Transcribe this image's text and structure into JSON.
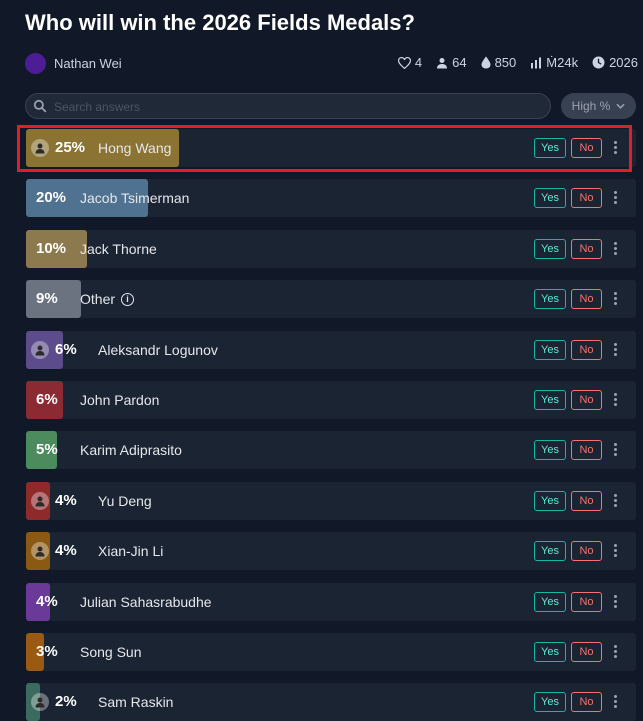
{
  "title": "Who will win the 2026 Fields Medals?",
  "author": "Nathan Wei",
  "stats": {
    "likes": "4",
    "traders": "64",
    "liquidity": "850",
    "volume": "Ṁ24k",
    "closes": "2026"
  },
  "search": {
    "placeholder": "Search answers"
  },
  "sort": {
    "label": "High %"
  },
  "buttons": {
    "yes": "Yes",
    "no": "No"
  },
  "colors": {
    "highlight": "#e11d2a",
    "yes": "#14b8a6",
    "no": "#f87171"
  },
  "answers": [
    {
      "pct": "25%",
      "name": "Hong Wang",
      "probability": 0.25,
      "color": "#8a7333",
      "icon": "avatar-icon"
    },
    {
      "pct": "20%",
      "name": "Jacob Tsimerman",
      "probability": 0.2,
      "color": "#4e7290"
    },
    {
      "pct": "10%",
      "name": "Jack Thorne",
      "probability": 0.1,
      "color": "#8c7a4e"
    },
    {
      "pct": "9%",
      "name": "Other",
      "probability": 0.09,
      "color": "#6b7280",
      "info": "i"
    },
    {
      "pct": "6%",
      "name": "Aleksandr Logunov",
      "probability": 0.06,
      "color": "#5d4c8c",
      "icon": "avatar-icon"
    },
    {
      "pct": "6%",
      "name": "John Pardon",
      "probability": 0.06,
      "color": "#8b2a33"
    },
    {
      "pct": "5%",
      "name": "Karim Adiprasito",
      "probability": 0.05,
      "color": "#4b8b5e"
    },
    {
      "pct": "4%",
      "name": "Yu Deng",
      "probability": 0.04,
      "color": "#8f2a2a",
      "icon": "avatar-icon"
    },
    {
      "pct": "4%",
      "name": "Xian-Jin Li",
      "probability": 0.04,
      "color": "#8a5a12",
      "icon": "avatar-icon"
    },
    {
      "pct": "4%",
      "name": "Julian Sahasrabudhe",
      "probability": 0.04,
      "color": "#6b3a99"
    },
    {
      "pct": "3%",
      "name": "Song Sun",
      "probability": 0.03,
      "color": "#9a5a12"
    },
    {
      "pct": "2%",
      "name": "Sam Raskin",
      "probability": 0.02,
      "color": "#3b6b5e",
      "icon": "avatar-icon"
    }
  ]
}
